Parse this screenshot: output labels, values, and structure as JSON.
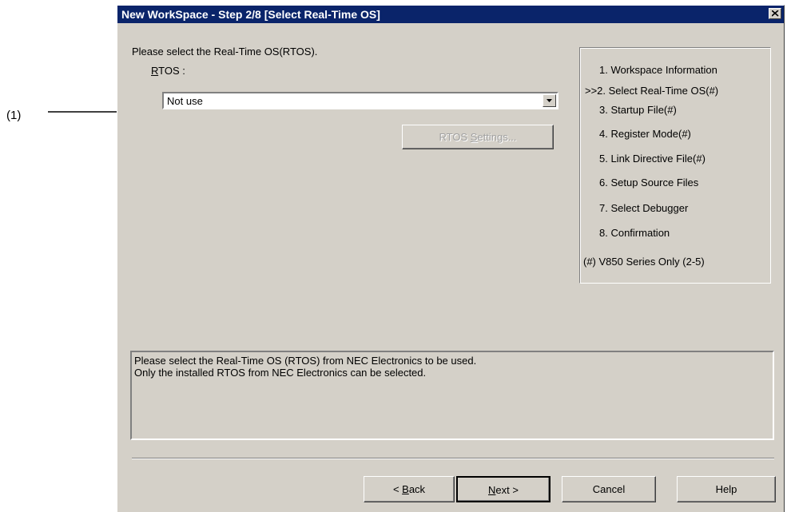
{
  "callout": {
    "label": "(1)"
  },
  "dialog": {
    "title": "New WorkSpace - Step 2/8 [Select Real-Time OS]",
    "prompt": "Please select the Real-Time OS(RTOS).",
    "rtos_label_mnemonic": "R",
    "rtos_label_rest": "TOS :",
    "rtos_selected": "Not use",
    "rtos_settings_label_pre": "RTOS ",
    "rtos_settings_label_mnemonic": "S",
    "rtos_settings_label_post": "ettings...",
    "steps": [
      {
        "label": "1. Workspace Information"
      },
      {
        "label": ">>2. Select Real-Time OS(#)"
      },
      {
        "label": "3. Startup File(#)"
      },
      {
        "label": "4. Register Mode(#)"
      },
      {
        "label": "5. Link Directive File(#)"
      },
      {
        "label": "6. Setup Source Files"
      },
      {
        "label": "7. Select Debugger"
      },
      {
        "label": "8. Confirmation"
      }
    ],
    "steps_note": "(#) V850 Series Only (2-5)",
    "description_line1": "Please select the Real-Time OS (RTOS) from NEC Electronics to be used.",
    "description_line2": "Only the installed RTOS from NEC Electronics can be selected.",
    "buttons": {
      "back_pre": "< ",
      "back_mnemonic": "B",
      "back_post": "ack",
      "next_mnemonic": "N",
      "next_post": "ext >",
      "cancel": "Cancel",
      "help": "Help"
    }
  },
  "colors": {
    "titlebar": "#0a246a",
    "face": "#d4d0c8"
  }
}
